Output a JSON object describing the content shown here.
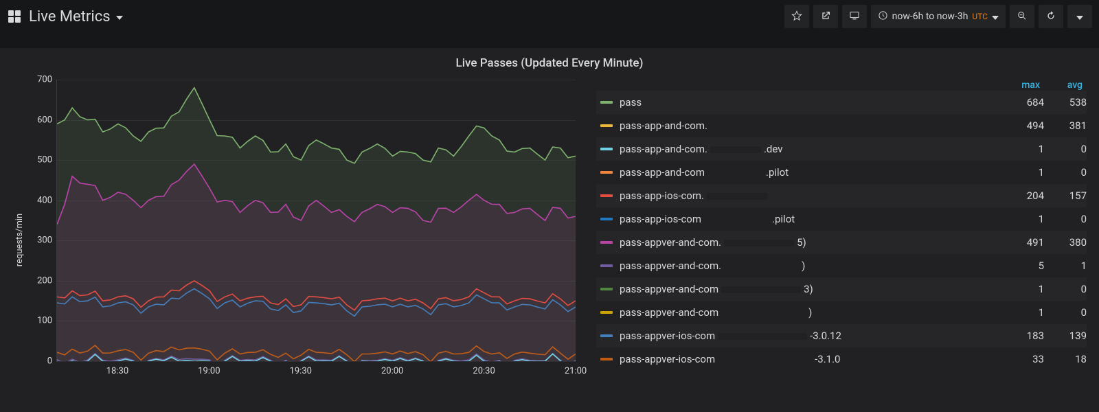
{
  "header": {
    "title": "Live Metrics",
    "timerange": "now-6h to now-3h",
    "utc": "UTC"
  },
  "panel": {
    "title": "Live Passes (Updated Every Minute)"
  },
  "legend": {
    "cols": {
      "max": "max",
      "avg": "avg"
    },
    "rows": [
      {
        "name": "pass",
        "suffix": "",
        "color": "#7eb26d",
        "max": 684,
        "avg": 538
      },
      {
        "name": "pass-app-and-com.",
        "suffix": "",
        "color": "#eab839",
        "max": 494,
        "avg": 381
      },
      {
        "name": "pass-app-and-com.",
        "suffix": ".dev",
        "color": "#6ed0e0",
        "max": 1,
        "avg": 0
      },
      {
        "name": "pass-app-and-com",
        "suffix": ".pilot",
        "color": "#ef843c",
        "max": 1,
        "avg": 0
      },
      {
        "name": "pass-app-ios-com.",
        "suffix": "",
        "color": "#e24d42",
        "max": 204,
        "avg": 157
      },
      {
        "name": "pass-app-ios-com",
        "suffix": ".pilot",
        "color": "#1f78c1",
        "max": 1,
        "avg": 0
      },
      {
        "name": "pass-appver-and-com.",
        "suffix": "5)",
        "color": "#ba43a9",
        "max": 491,
        "avg": 380
      },
      {
        "name": "pass-appver-and-com.",
        "suffix": ")",
        "color": "#705da0",
        "max": 5,
        "avg": 1
      },
      {
        "name": "pass-appver-and-com",
        "suffix": "3)",
        "color": "#508642",
        "max": 1,
        "avg": 0
      },
      {
        "name": "pass-appver-and-com",
        "suffix": ")",
        "color": "#cca300",
        "max": 1,
        "avg": 0
      },
      {
        "name": "pass-appver-ios-com",
        "suffix": "-3.0.12",
        "color": "#447ebc",
        "max": 183,
        "avg": 139
      },
      {
        "name": "pass-appver-ios-com",
        "suffix": "-3.1.0",
        "color": "#c15c17",
        "max": 33,
        "avg": 18
      }
    ]
  },
  "chart_data": {
    "type": "line",
    "title": "Live Passes (Updated Every Minute)",
    "xlabel": "",
    "ylabel": "requests/min",
    "ylim": [
      0,
      700
    ],
    "x": [
      "18:10",
      "18:15",
      "18:20",
      "18:25",
      "18:30",
      "18:35",
      "18:40",
      "18:45",
      "18:50",
      "18:55",
      "19:00",
      "19:05",
      "19:10",
      "19:15",
      "19:20",
      "19:25",
      "19:30",
      "19:35",
      "19:40",
      "19:45",
      "19:50",
      "19:55",
      "20:00",
      "20:05",
      "20:10",
      "20:15",
      "20:20",
      "20:25",
      "20:30",
      "20:35",
      "20:40",
      "20:45",
      "20:50",
      "20:55",
      "21:00"
    ],
    "xticks_shown": [
      "18:30",
      "19:00",
      "19:30",
      "20:00",
      "20:30",
      "21:00"
    ],
    "yticks": [
      0,
      100,
      200,
      300,
      400,
      500,
      600,
      700
    ],
    "series": [
      {
        "name": "pass",
        "color": "#7eb26d",
        "fill": true,
        "values": [
          590,
          630,
          600,
          570,
          590,
          560,
          570,
          580,
          620,
          680,
          600,
          560,
          530,
          560,
          520,
          540,
          500,
          550,
          530,
          500,
          520,
          540,
          510,
          520,
          500,
          530,
          510,
          560,
          580,
          550,
          520,
          530,
          500,
          530,
          510
        ]
      },
      {
        "name": "pass-appver-and-com.5)",
        "color": "#ba43a9",
        "fill": true,
        "values": [
          340,
          460,
          440,
          400,
          420,
          400,
          400,
          410,
          450,
          490,
          430,
          400,
          370,
          400,
          370,
          390,
          350,
          400,
          370,
          360,
          370,
          390,
          370,
          380,
          350,
          380,
          370,
          400,
          400,
          390,
          370,
          380,
          350,
          380,
          360
        ]
      },
      {
        "name": "pass-app-ios-com.",
        "color": "#e24d42",
        "fill": false,
        "values": [
          160,
          175,
          165,
          150,
          160,
          155,
          150,
          160,
          175,
          200,
          175,
          160,
          150,
          160,
          145,
          155,
          140,
          160,
          155,
          140,
          150,
          155,
          150,
          150,
          145,
          155,
          150,
          160,
          170,
          160,
          150,
          155,
          145,
          155,
          150
        ]
      },
      {
        "name": "pass-appver-ios-com-3.0.12",
        "color": "#447ebc",
        "fill": false,
        "values": [
          145,
          160,
          150,
          135,
          145,
          140,
          135,
          140,
          155,
          180,
          155,
          145,
          135,
          150,
          130,
          140,
          125,
          145,
          140,
          125,
          135,
          140,
          135,
          135,
          130,
          140,
          135,
          145,
          155,
          145,
          135,
          140,
          130,
          140,
          135
        ]
      },
      {
        "name": "pass-appver-ios-com-3.1.0",
        "color": "#c15c17",
        "fill": false,
        "values": [
          22,
          30,
          25,
          20,
          26,
          22,
          20,
          24,
          28,
          33,
          25,
          20,
          18,
          22,
          17,
          20,
          15,
          22,
          19,
          16,
          18,
          20,
          18,
          19,
          16,
          20,
          18,
          22,
          24,
          21,
          18,
          20,
          16,
          20,
          18
        ]
      },
      {
        "name": "pass-appver-and-com.)2",
        "color": "#705da0",
        "fill": false,
        "values": [
          4,
          5,
          3,
          2,
          3,
          2,
          2,
          3,
          4,
          5,
          3,
          2,
          2,
          3,
          2,
          2,
          1,
          3,
          2,
          1,
          2,
          2,
          2,
          2,
          1,
          2,
          2,
          3,
          3,
          2,
          2,
          2,
          1,
          2,
          2
        ]
      },
      {
        "name": "pass-app-and-com.dev",
        "color": "#6ed0e0",
        "fill": false,
        "values": [
          0,
          1,
          0,
          0,
          0,
          0,
          0,
          1,
          0,
          0,
          0,
          0,
          0,
          0,
          0,
          0,
          0,
          0,
          0,
          0,
          0,
          0,
          0,
          0,
          0,
          0,
          0,
          0,
          0,
          0,
          0,
          0,
          0,
          1,
          0
        ]
      }
    ]
  }
}
